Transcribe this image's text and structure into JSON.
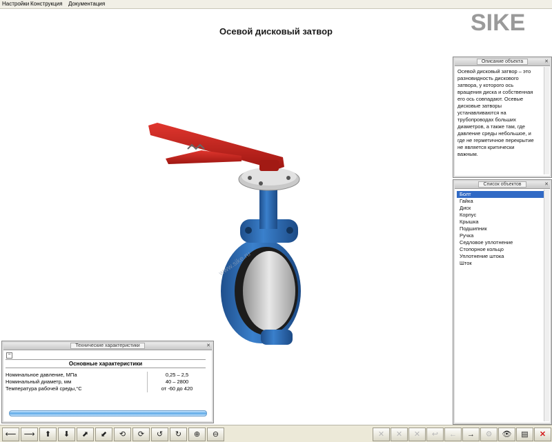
{
  "menu": {
    "items": [
      "Настройки",
      "Конструкция",
      "Документация"
    ]
  },
  "logo": {
    "text": "SIKE"
  },
  "main": {
    "title": "Осевой дисковый затвор",
    "watermark": "www.sike.ru"
  },
  "description_panel": {
    "title": "Описание объекта",
    "lines": [
      "Осевой дисковый затвор – это",
      "разновидность дискового",
      "затвора, у которого ось",
      "вращения диска и собственная",
      "его ось совпадают. Осевые",
      "дисковые затворы",
      "устанавливаются на",
      "трубопроводах больших",
      "диаметров, а также там, где",
      "давление среды небольшое, и",
      "где не герметичное перекрытие",
      "не является критически",
      "важным."
    ]
  },
  "objects_panel": {
    "title": "Список объектов",
    "selected_index": 0,
    "items": [
      "Болт",
      "Гайка",
      "Диск",
      "Корпус",
      "Крышка",
      "Подшипник",
      "Ручка",
      "Седловое уплотнение",
      "Стопорное кольцо",
      "Уплотнение штока",
      "Шток"
    ]
  },
  "specs_panel": {
    "title": "Технические характеристики",
    "header": "Основные характеристики",
    "rows": [
      {
        "key": "Номинальное давление, МПа",
        "value": "0,25 – 2,5"
      },
      {
        "key": "Номинальный диаметр, мм",
        "value": "40 – 2800"
      },
      {
        "key": "Температура рабочей среды,°С",
        "value": "от -60 до 420"
      }
    ]
  },
  "toolbar": {
    "left": [
      {
        "name": "arrow-left-icon",
        "glyph": "⟵"
      },
      {
        "name": "arrow-right-icon",
        "glyph": "⟶"
      },
      {
        "name": "arrow-up-icon",
        "glyph": "⬆"
      },
      {
        "name": "arrow-down-icon",
        "glyph": "⬇"
      },
      {
        "name": "arrow-diag-up-icon",
        "glyph": "⬈"
      },
      {
        "name": "arrow-diag-down-icon",
        "glyph": "⬋"
      },
      {
        "name": "rotate-x-icon",
        "glyph": "⟲"
      },
      {
        "name": "rotate-y-icon",
        "glyph": "⟳"
      },
      {
        "name": "rotate-z-left-icon",
        "glyph": "↺"
      },
      {
        "name": "rotate-z-right-icon",
        "glyph": "↻"
      },
      {
        "name": "zoom-in-icon",
        "glyph": "⊕"
      },
      {
        "name": "zoom-out-icon",
        "glyph": "⊖"
      }
    ],
    "right": [
      {
        "name": "explode-icon",
        "glyph": "✕",
        "disabled": true
      },
      {
        "name": "assemble-icon",
        "glyph": "✕",
        "disabled": true
      },
      {
        "name": "split-icon",
        "glyph": "✕",
        "disabled": true
      },
      {
        "name": "undo-icon",
        "glyph": "↩",
        "disabled": true
      },
      {
        "name": "back-icon",
        "glyph": "←",
        "disabled": true
      },
      {
        "name": "forward-icon",
        "glyph": "→"
      },
      {
        "name": "settings-icon",
        "glyph": "⚙",
        "disabled": true
      },
      {
        "name": "view-icon",
        "glyph": "👁"
      },
      {
        "name": "document-icon",
        "glyph": "▤"
      },
      {
        "name": "close-icon",
        "glyph": "✕",
        "red": true
      }
    ]
  },
  "colors": {
    "body_blue": "#2f6fb8",
    "handle_red": "#c8221b",
    "disc_grey": "#c8c8c8",
    "accent_blue": "#316ac5"
  }
}
